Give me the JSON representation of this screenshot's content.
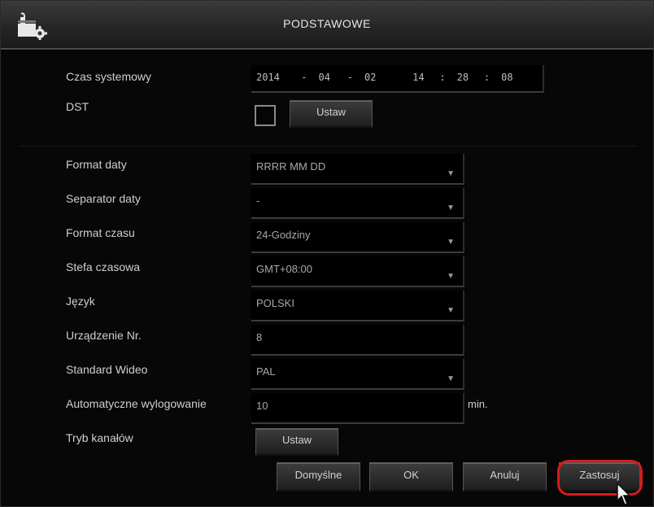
{
  "window": {
    "title": "PODSTAWOWE"
  },
  "system_time": {
    "label": "Czas systemowy",
    "year": "2014",
    "sep1": "-",
    "month": "04",
    "sep2": "-",
    "day": "02",
    "hour": "14",
    "sep3": ":",
    "minute": "28",
    "sep4": ":",
    "second": "08"
  },
  "dst": {
    "label": "DST",
    "button": "Ustaw"
  },
  "date_format": {
    "label": "Format daty",
    "value": "RRRR MM DD"
  },
  "date_separator": {
    "label": "Separator daty",
    "value": "-"
  },
  "time_format": {
    "label": "Format czasu",
    "value": "24-Godziny"
  },
  "time_zone": {
    "label": "Stefa czasowa",
    "value": "GMT+08:00"
  },
  "language": {
    "label": "Język",
    "value": "POLSKI"
  },
  "device_no": {
    "label": "Urządzenie Nr.",
    "value": "8"
  },
  "video_standard": {
    "label": "Standard Wideo",
    "value": "PAL"
  },
  "auto_logout": {
    "label": "Automatyczne wylogowanie",
    "value": "10",
    "unit": "min."
  },
  "channel_mode": {
    "label": "Tryb kanałów",
    "button": "Ustaw"
  },
  "footer": {
    "default": "Domyślne",
    "ok": "OK",
    "cancel": "Anuluj",
    "apply": "Zastosuj"
  },
  "colors": {
    "highlight": "#d91919",
    "background": "#070707"
  },
  "icons": {
    "app": "settings-gear-icon",
    "dropdown": "triangle-down-icon",
    "cursor": "mouse-pointer-icon"
  }
}
